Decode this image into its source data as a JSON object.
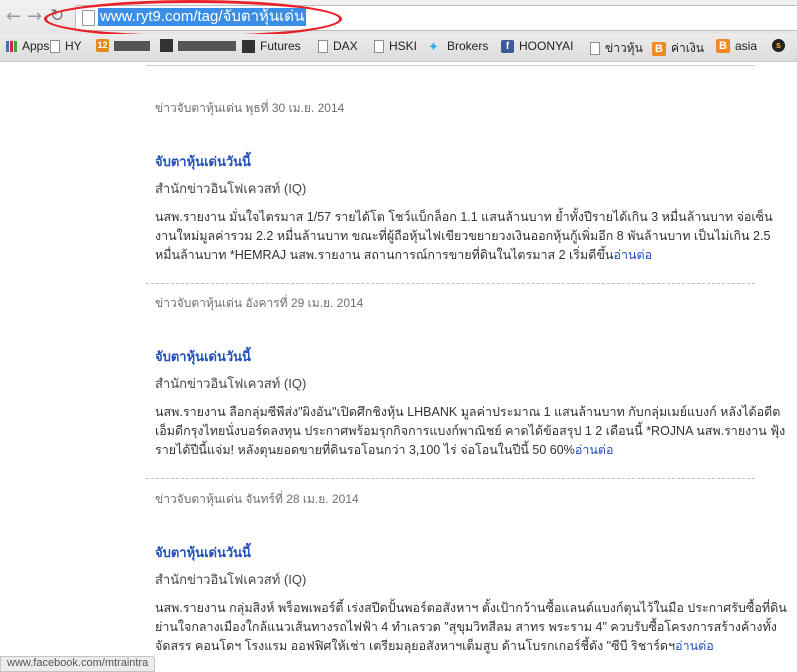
{
  "browser": {
    "url": "www.ryt9.com/tag/จับตาหุ้นเด่น",
    "bookmarks": [
      {
        "label": "Apps",
        "icon": "apps-grid-icon"
      },
      {
        "label": "HY",
        "icon": "page-icon"
      },
      {
        "label": "",
        "icon": "orange-site-icon"
      },
      {
        "label": "",
        "icon": "dark-site-icon"
      },
      {
        "label": "Futures",
        "icon": "dark-site-icon"
      },
      {
        "label": "DAX",
        "icon": "page-icon"
      },
      {
        "label": "HSKI",
        "icon": "page-icon"
      },
      {
        "label": "Brokers",
        "icon": "twitter-icon"
      },
      {
        "label": "HOONYAI",
        "icon": "facebook-icon"
      },
      {
        "label": "ข่าวหุ้น",
        "icon": "page-icon"
      },
      {
        "label": "ค่าเงิน",
        "icon": "blogger-icon"
      },
      {
        "label": "asia",
        "icon": "blogger-icon"
      },
      {
        "label": "s",
        "icon": "s-site-icon"
      }
    ],
    "status_url": "www.facebook.com/mtraintra"
  },
  "articles": [
    {
      "date": "ข่าวจับตาหุ้นเด่น พุธที่ 30 เม.ย. 2014",
      "title": "จับตาหุ้นเด่นวันนี้",
      "source": "สำนักข่าวอินโฟเควสท์ (IQ)",
      "body": "นสพ.รายงาน มั่นใจไตรมาส 1/57 รายได้โต โชว์แบ็กล็อก 1.1 แสนล้านบาท ย้ำทั้งปีรายได้เกิน 3 หมื่นล้านบาท จ่อเซ็นงานใหม่มูลค่ารวม 2.2 หมื่นล้านบาท ขณะที่ผู้ถือหุ้นไฟเขียวขยายวงเงินออกหุ้นกู้เพิ่มอีก 8 พันล้านบาท เป็นไม่เกิน 2.5 หมื่นล้านบาท *HEMRAJ นสพ.รายงาน สถานการณ์การขายที่ดินในไตรมาส 2 เริ่มดีขึ้น",
      "more": "อ่านต่อ"
    },
    {
      "date": "ข่าวจับตาหุ้นเด่น อังคารที่ 29 เม.ย. 2014",
      "title": "จับตาหุ้นเด่นวันนี้",
      "source": "สำนักข่าวอินโฟเควสท์ (IQ)",
      "body": "นสพ.รายงาน ลือกลุ่มซีพีส่ง\"ผิงอัน\"เปิดศึกชิงหุ้น LHBANK มูลค่าประมาณ 1 แสนล้านบาท กับกลุ่มเมย์แบงก์ หลังได้อดีตเอ็มดีกรุงไทยนั่งบอร์ดลงทุน ประกาศพร้อมรุกกิจการแบงก์พาณิชย์ คาดได้ข้อสรุป 1 2 เดือนนี้ *ROJNA นสพ.รายงาน ฟุ้งรายได้ปีนี้แจ่ม! หลังตุนยอดขายที่ดินรอโอนกว่า 3,100 ไร่ จ่อโอนในปีนี้ 50 60%",
      "more": "อ่านต่อ"
    },
    {
      "date": "ข่าวจับตาหุ้นเด่น จันทร์ที่ 28 เม.ย. 2014",
      "title": "จับตาหุ้นเด่นวันนี้",
      "source": "สำนักข่าวอินโฟเควสท์ (IQ)",
      "body": "นสพ.รายงาน กลุ่มสิงห์ พร็อพเพอร์ตี้ เร่งสปีดปั้นพอร์ตอสังหาฯ ตั้งเป้ากว้านซื้อแลนด์แบงก์ตุนไว้ในมือ ประกาศรับซื้อที่ดินย่านใจกลางเมืองใกล้แนวเส้นทางรถไฟฟ้า 4 ทำเลรวด \"สุขุมวิทสีลม สาทร พระราม 4\" ควบรับซื้อโครงการสร้างค้างทั้งจัดสรร คอนโดฯ โรงแรม ออฟฟิศให้เช่า เตรียมลุยอสังหาฯเต็มสูบ ด้านโบรกเกอร์ชี้ดัง \"ซีบี ริชาร์ดฯ",
      "more": "อ่านต่อ"
    }
  ]
}
